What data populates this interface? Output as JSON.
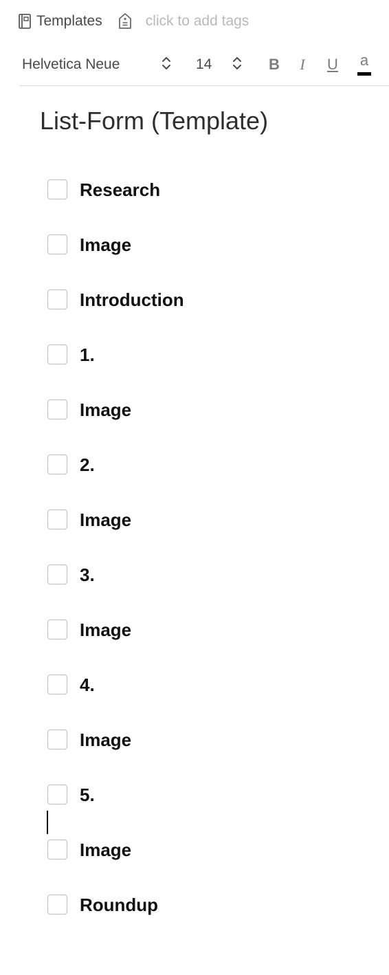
{
  "header": {
    "notebook_name": "Templates",
    "notebook_icon": "notebook-icon",
    "tag_icon": "tag-icon",
    "tag_placeholder": "click to add tags"
  },
  "toolbar": {
    "font_family_value": "Helvetica Neue",
    "font_size_value": "14",
    "bold_label": "B",
    "italic_label": "I",
    "underline_label": "U",
    "text_color_label": "a",
    "text_color": "#000000"
  },
  "note": {
    "title": "List-Form (Template)",
    "checklist": [
      {
        "label": "Research",
        "checked": false
      },
      {
        "label": "Image",
        "checked": false
      },
      {
        "label": "Introduction",
        "checked": false
      },
      {
        "label": "1.",
        "checked": false
      },
      {
        "label": "Image",
        "checked": false
      },
      {
        "label": "2.",
        "checked": false
      },
      {
        "label": "Image",
        "checked": false
      },
      {
        "label": "3.",
        "checked": false
      },
      {
        "label": "Image",
        "checked": false
      },
      {
        "label": "4.",
        "checked": false
      },
      {
        "label": "Image",
        "checked": false
      },
      {
        "label": "5.",
        "checked": false
      },
      {
        "label": "Image",
        "checked": false
      },
      {
        "label": "Roundup",
        "checked": false
      }
    ]
  }
}
